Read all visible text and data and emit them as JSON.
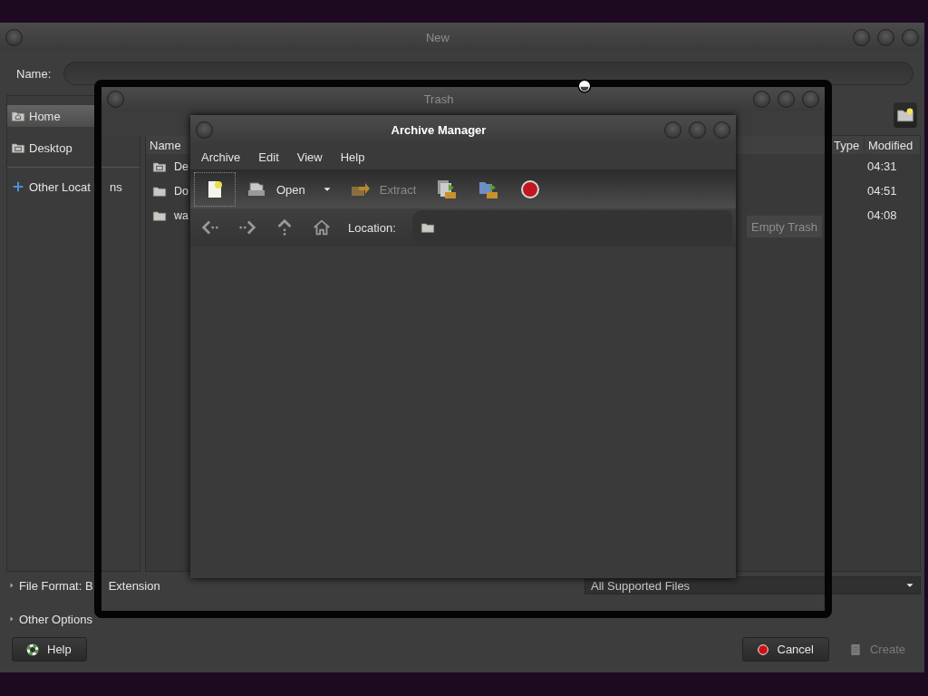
{
  "dialog": {
    "title": "New",
    "focused": false,
    "name_label": "Name:",
    "sidebar": [
      {
        "items": [
          {
            "kind": "home",
            "label_parts": [
              "Home"
            ],
            "selected": true
          },
          {
            "kind": "desktop",
            "label_parts": [
              "Desktop"
            ],
            "selected": false
          }
        ]
      },
      {
        "items": [
          {
            "kind": "plus",
            "label_parts": [
              "Other Locat",
              "ns"
            ],
            "selected": false
          }
        ]
      }
    ],
    "columns": [
      "Name",
      "Type",
      "Modified"
    ],
    "rows": [
      {
        "kind": "desktop",
        "name": "De",
        "modified": "04:31"
      },
      {
        "kind": "folder",
        "name": "Do",
        "modified": "04:51"
      },
      {
        "kind": "folder",
        "name": "wa",
        "modified": "04:08"
      }
    ],
    "file_format": {
      "label_parts": [
        "File Format: B",
        "Extension"
      ],
      "expanded": false
    },
    "other_options": {
      "label_parts": [
        "Other Options"
      ],
      "expanded": false
    },
    "filter": "All Supported Files",
    "buttons": [
      {
        "kind": "help",
        "label": "Help",
        "disabled": false
      },
      {
        "kind": "cancel",
        "label": "Cancel",
        "disabled": false
      },
      {
        "kind": "create",
        "label": "Create",
        "disabled": true
      }
    ]
  },
  "trash": {
    "title": "Trash",
    "focused": false,
    "empty_button": {
      "label": "Empty Trash",
      "disabled": true
    }
  },
  "archive": {
    "title": "Archive Manager",
    "focused": true,
    "menu": [
      "Archive",
      "Edit",
      "View",
      "Help"
    ],
    "toolbar": [
      {
        "kind": "new",
        "focused": true,
        "disabled": false
      },
      {
        "kind": "open",
        "label": "Open",
        "focused": false,
        "disabled": false
      },
      {
        "kind": "extract",
        "label": "Extract",
        "focused": false,
        "disabled": true
      },
      {
        "kind": "add-files",
        "focused": false,
        "disabled": false
      },
      {
        "kind": "add-folder",
        "focused": false,
        "disabled": false
      },
      {
        "kind": "stop",
        "focused": false,
        "disabled": false
      }
    ],
    "location": [
      {
        "kind": "back"
      },
      {
        "kind": "forward"
      },
      {
        "kind": "up"
      },
      {
        "kind": "home"
      }
    ],
    "location_label": "Location:"
  }
}
